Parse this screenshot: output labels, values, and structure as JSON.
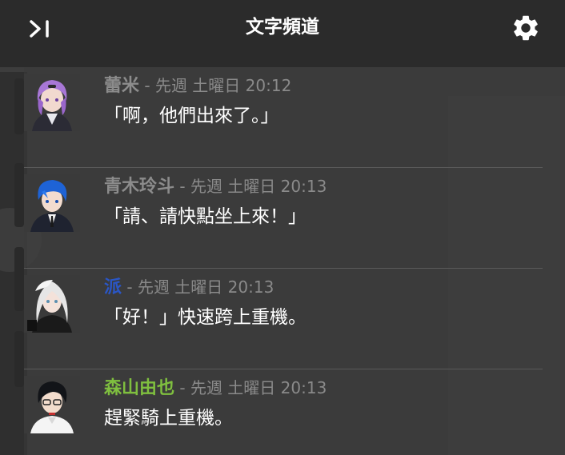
{
  "header": {
    "title": "文字頻道",
    "collapse_icon": "collapse-panel-icon",
    "settings_icon": "gear-icon"
  },
  "messages": [
    {
      "author": "蕾米",
      "author_color": "#8c8c8c",
      "separator": " - ",
      "timestamp": "先週 土曜日 20:12",
      "text": "「啊，他們出來了。」",
      "avatar": "purple-hair-avatar"
    },
    {
      "author": "青木玲斗",
      "author_color": "#8c8c8c",
      "separator": " - ",
      "timestamp": "先週 土曜日 20:13",
      "text": "「請、請快點坐上來！」",
      "avatar": "blue-hair-avatar"
    },
    {
      "author": "派",
      "author_color": "#2a56c6",
      "separator": " - ",
      "timestamp": "先週 土曜日 20:13",
      "text": "「好！」快速跨上重機。",
      "avatar": "white-hair-avatar"
    },
    {
      "author": "森山由也",
      "author_color": "#7fbf3f",
      "separator": " - ",
      "timestamp": "先週 土曜日 20:13",
      "text": "趕緊騎上重機。",
      "avatar": "black-hair-avatar"
    }
  ]
}
